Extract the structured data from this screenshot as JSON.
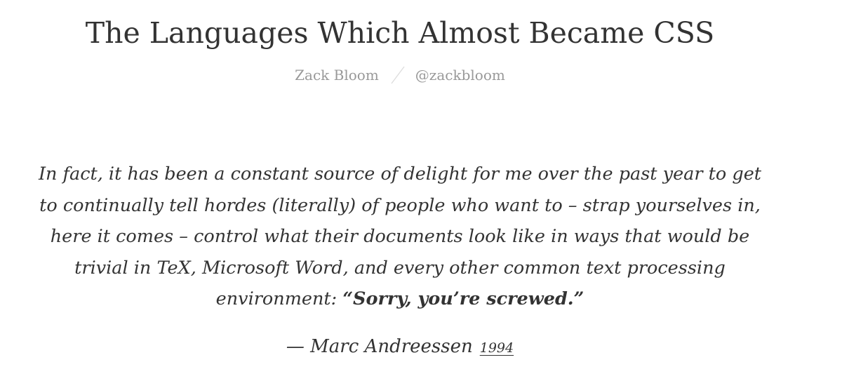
{
  "article": {
    "title": "The Languages Which Almost Became CSS",
    "author_name": "Zack Bloom",
    "author_handle": "@zackbloom"
  },
  "quote": {
    "lines": [
      "In fact, it has been a constant source of delight for me over the past year to get",
      "to continually tell hordes (literally) of people who want to – strap yourselves in,",
      "here it comes – control what their documents look like in ways that would be",
      "trivial in TeX, Microsoft Word, and every other common text processing"
    ],
    "last_line_prefix": "environment: ",
    "last_line_emphasis": "“Sorry, you’re screwed.”",
    "attribution": "— Marc Andreessen",
    "year": "1994"
  },
  "colors": {
    "text": "#333333",
    "muted": "#999999",
    "separator": "#dddddd"
  },
  "icons": {
    "separator": "slash-divider"
  }
}
